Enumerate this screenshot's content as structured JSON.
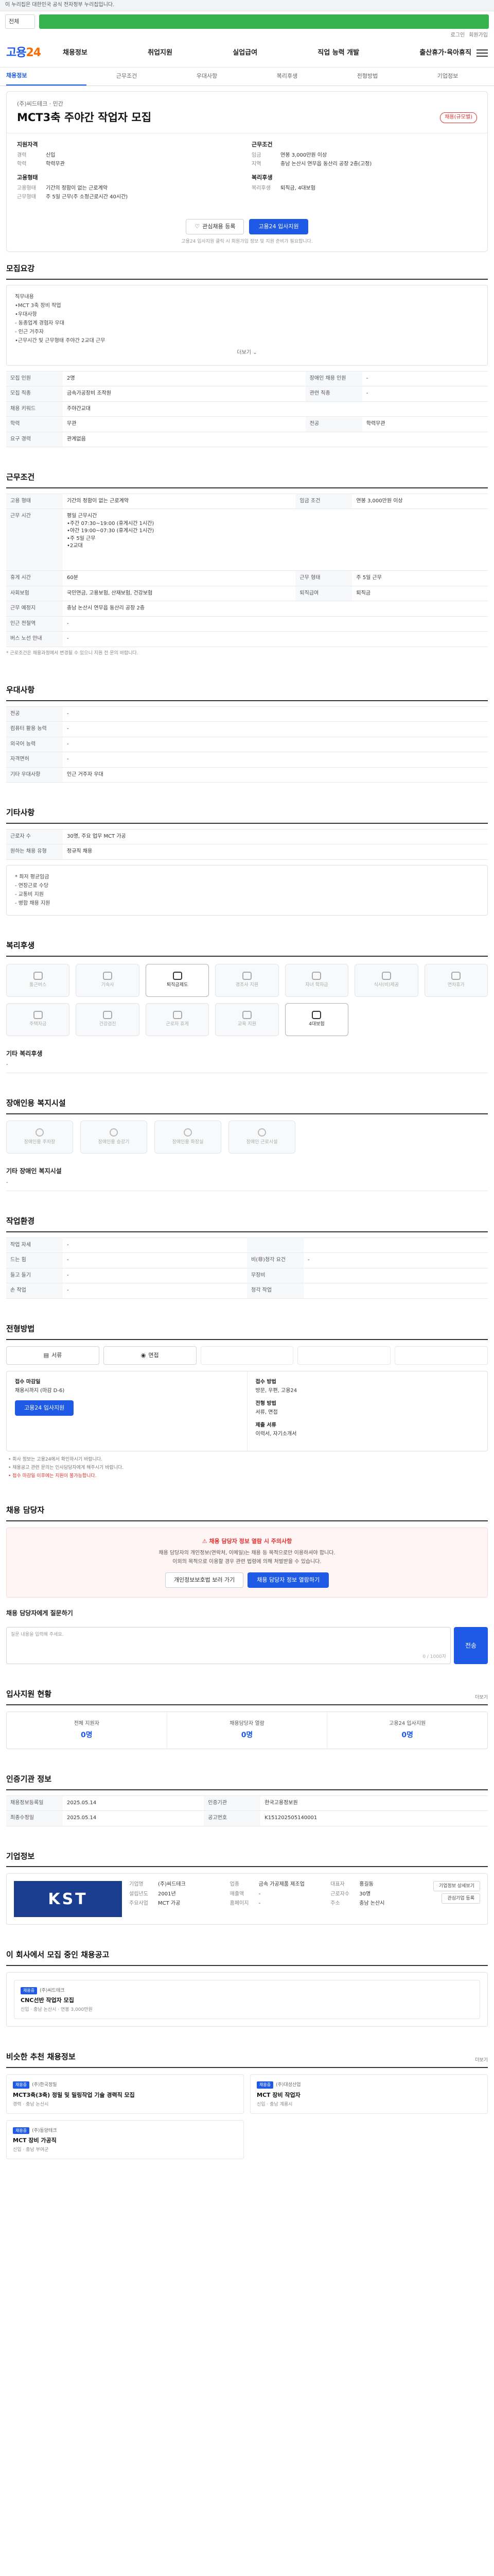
{
  "topbar": {
    "text": "이 누리집은 대한민국 공식 전자정부 누리집입니다."
  },
  "search": {
    "scope": "전체",
    "placeholder": ""
  },
  "util": {
    "login": "로그인",
    "join": "회원가입"
  },
  "gnb": {
    "logo_a": "고용",
    "logo_b": "24",
    "items": [
      "채용정보",
      "취업지원",
      "실업급여",
      "직업 능력 개발",
      "출산휴가·육아휴직"
    ]
  },
  "tabs": [
    "채용정보",
    "근무조건",
    "우대사항",
    "복리후생",
    "전형방법",
    "기업정보"
  ],
  "header": {
    "corp_line": "(주)씨드테크 · 민간",
    "title": "MCT3축 주야간 작업자 모집",
    "badge": "채용(규모별)"
  },
  "summary": {
    "left_title": "지원자격",
    "left_rows": [
      [
        "경력",
        "신입"
      ],
      [
        "학력",
        "학력무관"
      ]
    ],
    "left2_title": "고용형태",
    "left2_rows": [
      [
        "고용형태",
        "기간의 정함이 없는 근로계약"
      ],
      [
        "근무형태",
        "주 5일 근무(주 소정근로시간 40시간)"
      ]
    ],
    "right_title": "근무조건",
    "right_rows": [
      [
        "임금",
        "연봉 3,000만원 이상"
      ],
      [
        "지역",
        "충남 논산시 연무읍 동산리 공장 2층(고정)"
      ]
    ],
    "right2_title": "복리후생",
    "right2_rows": [
      [
        "복리후생",
        "퇴직금, 4대보험"
      ]
    ]
  },
  "actions": {
    "scrap": "관심채용 등록",
    "apply": "고용24 입사지원"
  },
  "note": "고용24 입사지원 클릭 시 회원가입 정보 및 지원 준비가 필요합니다.",
  "recruit": {
    "title": "모집요강",
    "box_lines": [
      "직무내용",
      "•MCT 3축 장비 작업",
      "",
      "•우대사항",
      "- 동종업계 경험자 우대",
      "- 인근 거주자",
      "•근무시간 및 근무형태 주야간 2교대 근무"
    ],
    "more": "더보기",
    "rows": [
      [
        "모집 인원",
        "2명",
        "장애인 채용 인원",
        "-"
      ],
      [
        "모집 직종",
        "금속가공장비 조작원",
        "관련 직종",
        "-"
      ],
      [
        "채용 키워드",
        "주야간교대",
        null,
        null
      ],
      [
        "학력",
        "무관",
        "전공",
        "학력무관"
      ],
      [
        "요구 경력",
        "관계없음",
        null,
        null
      ]
    ]
  },
  "conditions": {
    "title": "근무조건",
    "rows": [
      [
        "고용 형태",
        "기간의 정함이 없는 근로계약",
        "임금 조건",
        "연봉 3,000만원 이상"
      ],
      [
        "근무 시간",
        "평일 근무시간\n•주간 07:30~19:00 (휴게시간 1시간)\n•야간 19:00~07:30 (휴게시간 1시간)\n•주 5일 근무\n•2교대",
        "",
        ""
      ],
      [
        "휴게 시간",
        "60분",
        "근무 형태",
        "주 5일 근무"
      ],
      [
        "사회보험",
        "국민연금, 고용보험, 산재보험, 건강보험",
        "퇴직급여",
        "퇴직금"
      ],
      [
        "근무 예정지",
        "충남 논산시 연무읍 동산리 공장 2층",
        "",
        ""
      ],
      [
        "인근 전철역",
        "-",
        "",
        ""
      ],
      [
        "버스 노선 안내",
        "-",
        "",
        ""
      ]
    ],
    "note": "* 근로조건은 채용과정에서 변경될 수 있으니 지원 전 문의 바랍니다."
  },
  "pref": {
    "title": "우대사항",
    "rows": [
      [
        "전공",
        "-"
      ],
      [
        "컴퓨터 활용 능력",
        "-"
      ],
      [
        "외국어 능력",
        "-"
      ],
      [
        "자격면허",
        "-"
      ],
      [
        "기타 우대사항",
        "인근 거주자 우대"
      ]
    ]
  },
  "other": {
    "title": "기타사항",
    "rows": [
      [
        "근로자 수",
        "30명, 주요 업무 MCT 가공"
      ],
      [
        "원하는 채용 유형",
        "정규직 채용"
      ]
    ],
    "box_lines": [
      "* 최저 평균임금",
      "- 연장근로 수당",
      "- 교통비 지원",
      "- 병합 채용 지원"
    ]
  },
  "welfare": {
    "title": "복리후생",
    "items": [
      {
        "label": "통근버스",
        "on": false
      },
      {
        "label": "기숙사",
        "on": false
      },
      {
        "label": "퇴직금제도",
        "on": true
      },
      {
        "label": "경조사 지원",
        "on": false
      },
      {
        "label": "자녀 학자금",
        "on": false
      },
      {
        "label": "식사(비)제공",
        "on": false
      },
      {
        "label": "연차휴가",
        "on": false
      },
      {
        "label": "주택자금",
        "on": false
      },
      {
        "label": "건강검진",
        "on": false
      },
      {
        "label": "근로자 휴게",
        "on": false
      },
      {
        "label": "교육 지원",
        "on": false
      },
      {
        "label": "4대보험",
        "on": true
      }
    ],
    "etc_title": "기타 복리후생",
    "etc": "-"
  },
  "access": {
    "title": "장애인용 복지시설",
    "items": [
      "장애인용 주차장",
      "장애인용 승강기",
      "장애인용 화장실",
      "장애인 근로시설"
    ],
    "etc_title": "기타 장애인 복지시설",
    "etc": "-"
  },
  "env": {
    "title": "작업환경",
    "rows": [
      [
        "작업 자세",
        "-",
        "",
        ""
      ],
      [
        "드는 힘",
        "-",
        "비(非)청각 요건",
        "-"
      ],
      [
        "들고 들기",
        "-",
        "무장비",
        ""
      ],
      [
        "손 작업",
        "-",
        "청각 작업",
        ""
      ]
    ]
  },
  "process": {
    "title": "전형방법",
    "steps": [
      "서류",
      "면접",
      "",
      "",
      ""
    ],
    "labels": {
      "date": "접수 마감일",
      "method": "접수 방법",
      "type": "전형 방법",
      "docs": "제출 서류"
    },
    "date": "채용시까지 (마감 D-6)",
    "method": "방문, 우편, 고용24",
    "type": "서류, 면접",
    "docs": "이력서, 자기소개서",
    "apply": "고용24 입사지원",
    "bullets": [
      "• 회사 정보는 고용24에서 확인하시기 바랍니다.",
      "• 채용공고 관련 문의는 인사담당자에게 해주시기 바랍니다.",
      "• 접수 마감일 이후에는 지원이 불가능합니다."
    ]
  },
  "contact": {
    "title": "채용 담당자",
    "warn_head": "채용 담당자 정보 열람 시 주의사항",
    "warn_text": "채용 담당자의 개인정보(연락처, 이메일)는 채용 등 목적으로만 이용하셔야 합니다.\n이외의 목적으로 이용할 경우 관련 법령에 의해 처벌받을 수 있습니다.",
    "btn_a": "개인정보보호법 보러 가기",
    "btn_b": "채용 담당자 정보 열람하기",
    "inquiry_title": "채용 담당자에게 질문하기",
    "inquiry_placeholder": "질문 내용을 입력해 주세요.",
    "inquiry_count": "0 / 1000자",
    "inquiry_submit": "전송"
  },
  "stats": {
    "title": "입사지원 현황",
    "more": "더보기",
    "items": [
      {
        "l": "전체 지원자",
        "n": "0명"
      },
      {
        "l": "채용담당자 열람",
        "n": "0명"
      },
      {
        "l": "고용24 입사지원",
        "n": "0명"
      }
    ]
  },
  "info": {
    "title": "인증기관 정보",
    "rows": [
      [
        "채용정보등록일",
        "2025.05.14",
        "인증기관",
        "한국고용정보원"
      ],
      [
        "최종수정일",
        "2025.05.14",
        "공고번호",
        "K151202505140001"
      ]
    ]
  },
  "company": {
    "title": "기업정보",
    "logo": "KST",
    "cells": [
      [
        "기업명",
        "(주)씨드테크"
      ],
      [
        "업종",
        "금속 가공제품 제조업"
      ],
      [
        "대표자",
        "홍길동"
      ],
      [
        "설립년도",
        "2001년"
      ],
      [
        "매출액",
        "-"
      ],
      [
        "근로자수",
        "30명"
      ],
      [
        "주요사업",
        "MCT 가공"
      ],
      [
        "홈페이지",
        "-"
      ],
      [
        "주소",
        "충남 논산시"
      ]
    ],
    "btns": [
      "기업정보 상세보기",
      "관심기업 등록"
    ]
  },
  "reco": {
    "title": "이 회사에서 모집 중인 채용공고",
    "card": {
      "tag": "채용중",
      "co": "(주)씨드테크",
      "title": "CNC선반 작업자 모집",
      "meta": "신입 · 충남 논산시 · 연봉 3,000만원"
    }
  },
  "similar": {
    "title": "비슷한 추천 채용정보",
    "more": "더보기",
    "cards": [
      {
        "tag": "채용중",
        "co": "(주)한국정밀",
        "title": "MCT3축(3축) 정밀 및 밀링작업 기술 경력직 모집",
        "meta": "경력 · 충남 논산시"
      },
      {
        "tag": "채용중",
        "co": "(주)대성산업",
        "title": "MCT 장비 작업자",
        "meta": "신입 · 충남 계룡시"
      },
      {
        "tag": "채용중",
        "co": "(주)동양테크",
        "title": "MCT 장비 가공직",
        "meta": "신입 · 충남 부여군"
      }
    ]
  }
}
